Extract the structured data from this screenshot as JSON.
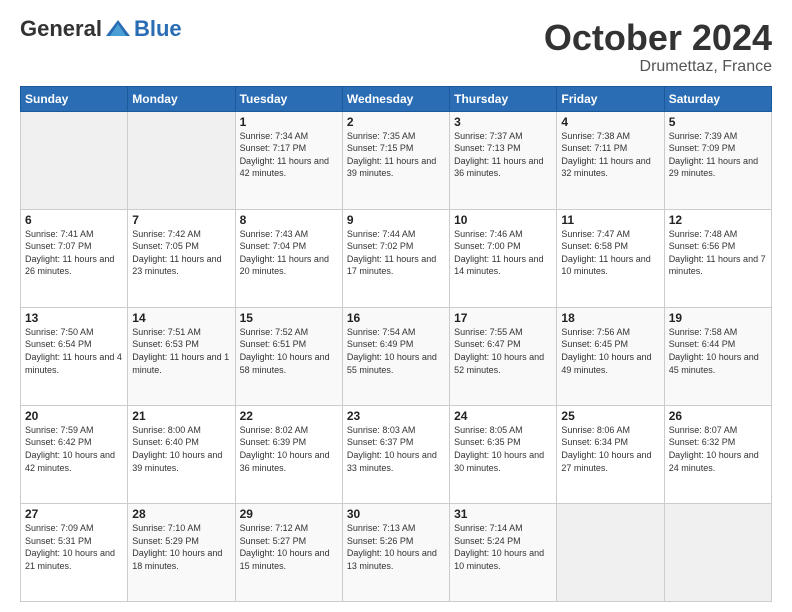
{
  "header": {
    "logo_general": "General",
    "logo_blue": "Blue",
    "month": "October 2024",
    "location": "Drumettaz, France"
  },
  "weekdays": [
    "Sunday",
    "Monday",
    "Tuesday",
    "Wednesday",
    "Thursday",
    "Friday",
    "Saturday"
  ],
  "weeks": [
    [
      {
        "day": "",
        "sunrise": "",
        "sunset": "",
        "daylight": ""
      },
      {
        "day": "",
        "sunrise": "",
        "sunset": "",
        "daylight": ""
      },
      {
        "day": "1",
        "sunrise": "Sunrise: 7:34 AM",
        "sunset": "Sunset: 7:17 PM",
        "daylight": "Daylight: 11 hours and 42 minutes."
      },
      {
        "day": "2",
        "sunrise": "Sunrise: 7:35 AM",
        "sunset": "Sunset: 7:15 PM",
        "daylight": "Daylight: 11 hours and 39 minutes."
      },
      {
        "day": "3",
        "sunrise": "Sunrise: 7:37 AM",
        "sunset": "Sunset: 7:13 PM",
        "daylight": "Daylight: 11 hours and 36 minutes."
      },
      {
        "day": "4",
        "sunrise": "Sunrise: 7:38 AM",
        "sunset": "Sunset: 7:11 PM",
        "daylight": "Daylight: 11 hours and 32 minutes."
      },
      {
        "day": "5",
        "sunrise": "Sunrise: 7:39 AM",
        "sunset": "Sunset: 7:09 PM",
        "daylight": "Daylight: 11 hours and 29 minutes."
      }
    ],
    [
      {
        "day": "6",
        "sunrise": "Sunrise: 7:41 AM",
        "sunset": "Sunset: 7:07 PM",
        "daylight": "Daylight: 11 hours and 26 minutes."
      },
      {
        "day": "7",
        "sunrise": "Sunrise: 7:42 AM",
        "sunset": "Sunset: 7:05 PM",
        "daylight": "Daylight: 11 hours and 23 minutes."
      },
      {
        "day": "8",
        "sunrise": "Sunrise: 7:43 AM",
        "sunset": "Sunset: 7:04 PM",
        "daylight": "Daylight: 11 hours and 20 minutes."
      },
      {
        "day": "9",
        "sunrise": "Sunrise: 7:44 AM",
        "sunset": "Sunset: 7:02 PM",
        "daylight": "Daylight: 11 hours and 17 minutes."
      },
      {
        "day": "10",
        "sunrise": "Sunrise: 7:46 AM",
        "sunset": "Sunset: 7:00 PM",
        "daylight": "Daylight: 11 hours and 14 minutes."
      },
      {
        "day": "11",
        "sunrise": "Sunrise: 7:47 AM",
        "sunset": "Sunset: 6:58 PM",
        "daylight": "Daylight: 11 hours and 10 minutes."
      },
      {
        "day": "12",
        "sunrise": "Sunrise: 7:48 AM",
        "sunset": "Sunset: 6:56 PM",
        "daylight": "Daylight: 11 hours and 7 minutes."
      }
    ],
    [
      {
        "day": "13",
        "sunrise": "Sunrise: 7:50 AM",
        "sunset": "Sunset: 6:54 PM",
        "daylight": "Daylight: 11 hours and 4 minutes."
      },
      {
        "day": "14",
        "sunrise": "Sunrise: 7:51 AM",
        "sunset": "Sunset: 6:53 PM",
        "daylight": "Daylight: 11 hours and 1 minute."
      },
      {
        "day": "15",
        "sunrise": "Sunrise: 7:52 AM",
        "sunset": "Sunset: 6:51 PM",
        "daylight": "Daylight: 10 hours and 58 minutes."
      },
      {
        "day": "16",
        "sunrise": "Sunrise: 7:54 AM",
        "sunset": "Sunset: 6:49 PM",
        "daylight": "Daylight: 10 hours and 55 minutes."
      },
      {
        "day": "17",
        "sunrise": "Sunrise: 7:55 AM",
        "sunset": "Sunset: 6:47 PM",
        "daylight": "Daylight: 10 hours and 52 minutes."
      },
      {
        "day": "18",
        "sunrise": "Sunrise: 7:56 AM",
        "sunset": "Sunset: 6:45 PM",
        "daylight": "Daylight: 10 hours and 49 minutes."
      },
      {
        "day": "19",
        "sunrise": "Sunrise: 7:58 AM",
        "sunset": "Sunset: 6:44 PM",
        "daylight": "Daylight: 10 hours and 45 minutes."
      }
    ],
    [
      {
        "day": "20",
        "sunrise": "Sunrise: 7:59 AM",
        "sunset": "Sunset: 6:42 PM",
        "daylight": "Daylight: 10 hours and 42 minutes."
      },
      {
        "day": "21",
        "sunrise": "Sunrise: 8:00 AM",
        "sunset": "Sunset: 6:40 PM",
        "daylight": "Daylight: 10 hours and 39 minutes."
      },
      {
        "day": "22",
        "sunrise": "Sunrise: 8:02 AM",
        "sunset": "Sunset: 6:39 PM",
        "daylight": "Daylight: 10 hours and 36 minutes."
      },
      {
        "day": "23",
        "sunrise": "Sunrise: 8:03 AM",
        "sunset": "Sunset: 6:37 PM",
        "daylight": "Daylight: 10 hours and 33 minutes."
      },
      {
        "day": "24",
        "sunrise": "Sunrise: 8:05 AM",
        "sunset": "Sunset: 6:35 PM",
        "daylight": "Daylight: 10 hours and 30 minutes."
      },
      {
        "day": "25",
        "sunrise": "Sunrise: 8:06 AM",
        "sunset": "Sunset: 6:34 PM",
        "daylight": "Daylight: 10 hours and 27 minutes."
      },
      {
        "day": "26",
        "sunrise": "Sunrise: 8:07 AM",
        "sunset": "Sunset: 6:32 PM",
        "daylight": "Daylight: 10 hours and 24 minutes."
      }
    ],
    [
      {
        "day": "27",
        "sunrise": "Sunrise: 7:09 AM",
        "sunset": "Sunset: 5:31 PM",
        "daylight": "Daylight: 10 hours and 21 minutes."
      },
      {
        "day": "28",
        "sunrise": "Sunrise: 7:10 AM",
        "sunset": "Sunset: 5:29 PM",
        "daylight": "Daylight: 10 hours and 18 minutes."
      },
      {
        "day": "29",
        "sunrise": "Sunrise: 7:12 AM",
        "sunset": "Sunset: 5:27 PM",
        "daylight": "Daylight: 10 hours and 15 minutes."
      },
      {
        "day": "30",
        "sunrise": "Sunrise: 7:13 AM",
        "sunset": "Sunset: 5:26 PM",
        "daylight": "Daylight: 10 hours and 13 minutes."
      },
      {
        "day": "31",
        "sunrise": "Sunrise: 7:14 AM",
        "sunset": "Sunset: 5:24 PM",
        "daylight": "Daylight: 10 hours and 10 minutes."
      },
      {
        "day": "",
        "sunrise": "",
        "sunset": "",
        "daylight": ""
      },
      {
        "day": "",
        "sunrise": "",
        "sunset": "",
        "daylight": ""
      }
    ]
  ]
}
